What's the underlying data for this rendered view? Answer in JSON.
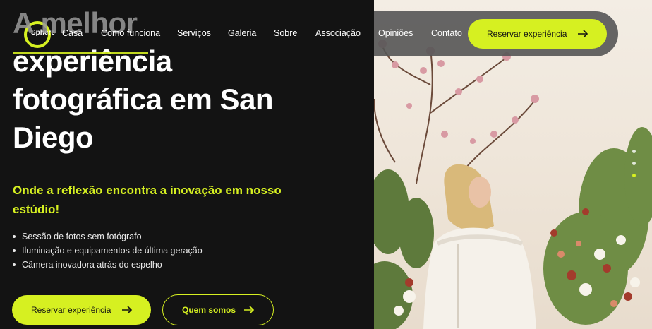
{
  "brand": {
    "name": "Sphere",
    "accent": "#d6f021"
  },
  "nav": {
    "items": [
      "Casa",
      "Como funciona",
      "Serviços",
      "Galeria",
      "Sobre",
      "Associação",
      "Opiniões",
      "Contato"
    ],
    "cta_label": "Reservar experiência"
  },
  "hero": {
    "title_ghost": "A melhor",
    "title_lines": [
      "experiência",
      "fotográfica em San",
      "Diego"
    ],
    "subtitle": "Onde a reflexão encontra a inovação em nosso estúdio!",
    "features": [
      "Sessão de fotos sem fotógrafo",
      "Iluminação e equipamentos de última geração",
      "Câmera inovadora atrás do espelho"
    ],
    "primary_button": "Reservar experiência",
    "secondary_button": "Quem somos"
  },
  "icons": {
    "arrow": "arrow-right-icon"
  },
  "slider": {
    "count": 3,
    "active_index": 2
  }
}
